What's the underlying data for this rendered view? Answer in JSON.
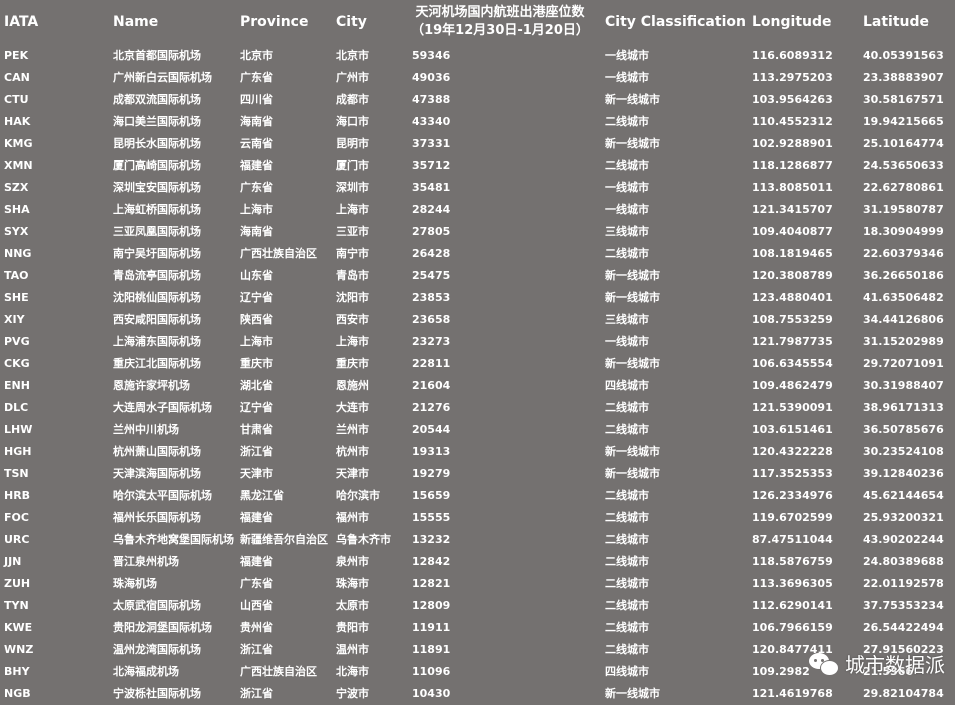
{
  "headers": {
    "iata": "IATA",
    "name": "Name",
    "province": "Province",
    "city": "City",
    "seats_line1": "天河机场国内航班出港座位数",
    "seats_line2": "（19年12月30日-1月20日）",
    "classification": "City Classification",
    "longitude": "Longitude",
    "latitude": "Latitude"
  },
  "rows": [
    [
      "PEK",
      "北京首都国际机场",
      "北京市",
      "北京市",
      "59346",
      "一线城市",
      "116.6089312",
      "40.05391563"
    ],
    [
      "CAN",
      "广州新白云国际机场",
      "广东省",
      "广州市",
      "49036",
      "一线城市",
      "113.2975203",
      "23.38883907"
    ],
    [
      "CTU",
      "成都双流国际机场",
      "四川省",
      "成都市",
      "47388",
      "新一线城市",
      "103.9564263",
      "30.58167571"
    ],
    [
      "HAK",
      "海口美兰国际机场",
      "海南省",
      "海口市",
      "43340",
      "二线城市",
      "110.4552312",
      "19.94215665"
    ],
    [
      "KMG",
      "昆明长水国际机场",
      "云南省",
      "昆明市",
      "37331",
      "新一线城市",
      "102.9288901",
      "25.10164774"
    ],
    [
      "XMN",
      "厦门高崎国际机场",
      "福建省",
      "厦门市",
      "35712",
      "二线城市",
      "118.1286877",
      "24.53650633"
    ],
    [
      "SZX",
      "深圳宝安国际机场",
      "广东省",
      "深圳市",
      "35481",
      "一线城市",
      "113.8085011",
      "22.62780861"
    ],
    [
      "SHA",
      "上海虹桥国际机场",
      "上海市",
      "上海市",
      "28244",
      "一线城市",
      "121.3415707",
      "31.19580787"
    ],
    [
      "SYX",
      "三亚凤凰国际机场",
      "海南省",
      "三亚市",
      "27805",
      "三线城市",
      "109.4040877",
      "18.30904999"
    ],
    [
      "NNG",
      "南宁吴圩国际机场",
      "广西壮族自治区",
      "南宁市",
      "26428",
      "二线城市",
      "108.1819465",
      "22.60379346"
    ],
    [
      "TAO",
      "青岛流亭国际机场",
      "山东省",
      "青岛市",
      "25475",
      "新一线城市",
      "120.3808789",
      "36.26650186"
    ],
    [
      "SHE",
      "沈阳桃仙国际机场",
      "辽宁省",
      "沈阳市",
      "23853",
      "新一线城市",
      "123.4880401",
      "41.63506482"
    ],
    [
      "XIY",
      "西安咸阳国际机场",
      "陕西省",
      "西安市",
      "23658",
      "三线城市",
      "108.7553259",
      "34.44126806"
    ],
    [
      "PVG",
      "上海浦东国际机场",
      "上海市",
      "上海市",
      "23273",
      "一线城市",
      "121.7987735",
      "31.15202989"
    ],
    [
      "CKG",
      "重庆江北国际机场",
      "重庆市",
      "重庆市",
      "22811",
      "新一线城市",
      "106.6345554",
      "29.72071091"
    ],
    [
      "ENH",
      "恩施许家坪机场",
      "湖北省",
      "恩施州",
      "21604",
      "四线城市",
      "109.4862479",
      "30.31988407"
    ],
    [
      "DLC",
      "大连周水子国际机场",
      "辽宁省",
      "大连市",
      "21276",
      "二线城市",
      "121.5390091",
      "38.96171313"
    ],
    [
      "LHW",
      "兰州中川机场",
      "甘肃省",
      "兰州市",
      "20544",
      "二线城市",
      "103.6151461",
      "36.50785676"
    ],
    [
      "HGH",
      "杭州萧山国际机场",
      "浙江省",
      "杭州市",
      "19313",
      "新一线城市",
      "120.4322228",
      "30.23524108"
    ],
    [
      "TSN",
      "天津滨海国际机场",
      "天津市",
      "天津市",
      "19279",
      "新一线城市",
      "117.3525353",
      "39.12840236"
    ],
    [
      "HRB",
      "哈尔滨太平国际机场",
      "黑龙江省",
      "哈尔滨市",
      "15659",
      "二线城市",
      "126.2334976",
      "45.62144654"
    ],
    [
      "FOC",
      "福州长乐国际机场",
      "福建省",
      "福州市",
      "15555",
      "二线城市",
      "119.6702599",
      "25.93200321"
    ],
    [
      "URC",
      "乌鲁木齐地窝堡国际机场",
      "新疆维吾尔自治区",
      "乌鲁木齐市",
      "13232",
      "二线城市",
      "87.47511044",
      "43.90202244"
    ],
    [
      "JJN",
      "晋江泉州机场",
      "福建省",
      "泉州市",
      "12842",
      "二线城市",
      "118.5876759",
      "24.80389688"
    ],
    [
      "ZUH",
      "珠海机场",
      "广东省",
      "珠海市",
      "12821",
      "二线城市",
      "113.3696305",
      "22.01192578"
    ],
    [
      "TYN",
      "太原武宿国际机场",
      "山西省",
      "太原市",
      "12809",
      "二线城市",
      "112.6290141",
      "37.75353234"
    ],
    [
      "KWE",
      "贵阳龙洞堡国际机场",
      "贵州省",
      "贵阳市",
      "11911",
      "二线城市",
      "106.7966159",
      "26.54422494"
    ],
    [
      "WNZ",
      "温州龙湾国际机场",
      "浙江省",
      "温州市",
      "11891",
      "二线城市",
      "120.8477411",
      "27.91560223"
    ],
    [
      "BHY",
      "北海福成机场",
      "广西壮族自治区",
      "北海市",
      "11096",
      "四线城市",
      "109.2982",
      "21.5366"
    ],
    [
      "NGB",
      "宁波栎社国际机场",
      "浙江省",
      "宁波市",
      "10430",
      "新一线城市",
      "121.4619768",
      "29.82104784"
    ]
  ],
  "watermark": {
    "text": "城市数据派",
    "icon": "wechat-icon"
  }
}
